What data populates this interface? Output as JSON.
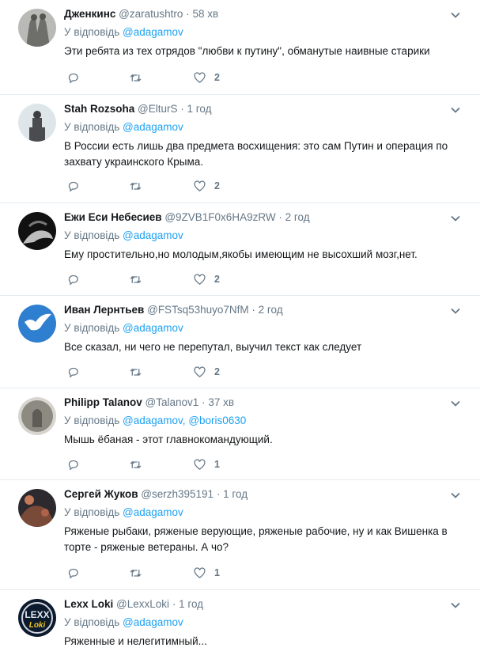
{
  "reply_prefix": "У відповідь",
  "tweets": [
    {
      "name": "Дженкинс",
      "handle": "@zaratushtro",
      "time": "58 хв",
      "mentions": [
        "@adagamov"
      ],
      "text": "Эти ребята из тех отрядов \"любви к путину\", обманутые наивные старики",
      "likes": "2",
      "retweets": ""
    },
    {
      "name": "Stah Rozsoha",
      "handle": "@ElturS",
      "time": "1 год",
      "mentions": [
        "@adagamov"
      ],
      "text": "В России есть лишь два предмета восхищения: это сам Путин и операция по захвату украинского Крыма.",
      "likes": "2",
      "retweets": ""
    },
    {
      "name": "Ежи Еси Небесиев",
      "handle": "@9ZVB1F0x6HA9zRW",
      "time": "2 год",
      "mentions": [
        "@adagamov"
      ],
      "text": "Ему простительно,но молодым,якобы имеющим не высохший мозг,нет.",
      "likes": "2",
      "retweets": ""
    },
    {
      "name": "Иван Лернтьев",
      "handle": "@FSTsq53huyo7NfM",
      "time": "2 год",
      "mentions": [
        "@adagamov"
      ],
      "text": "Все сказал, ни чего не перепутал, выучил текст как следует",
      "likes": "2",
      "retweets": ""
    },
    {
      "name": "Philipp Talanov",
      "handle": "@Talanov1",
      "time": "37 хв",
      "mentions": [
        "@adagamov",
        "@boris0630"
      ],
      "text": "Мышь ёбаная - этот главнокомандующий.",
      "likes": "1",
      "retweets": ""
    },
    {
      "name": "Сергей Жуков",
      "handle": "@serzh395191",
      "time": "1 год",
      "mentions": [
        "@adagamov"
      ],
      "text": "Ряженые рыбаки, ряженые верующие, ряженые рабочие, ну и как Вишенка в торте - ряженые ветераны. А чо?",
      "likes": "1",
      "retweets": ""
    },
    {
      "name": "Lexx Loki",
      "handle": "@LexxLoki",
      "time": "1 год",
      "mentions": [
        "@adagamov"
      ],
      "text": "Ряженные и нелегитимный...",
      "likes": "",
      "retweets": "",
      "avatar_text": "LEXX Loki"
    }
  ],
  "icons": {
    "reply": "reply-icon",
    "retweet": "retweet-icon",
    "like": "heart-icon",
    "caret": "chevron-down-icon"
  },
  "colors": {
    "link": "#1da1f2",
    "muted": "#657786",
    "text": "#14171a",
    "border": "#e6ecf0"
  }
}
